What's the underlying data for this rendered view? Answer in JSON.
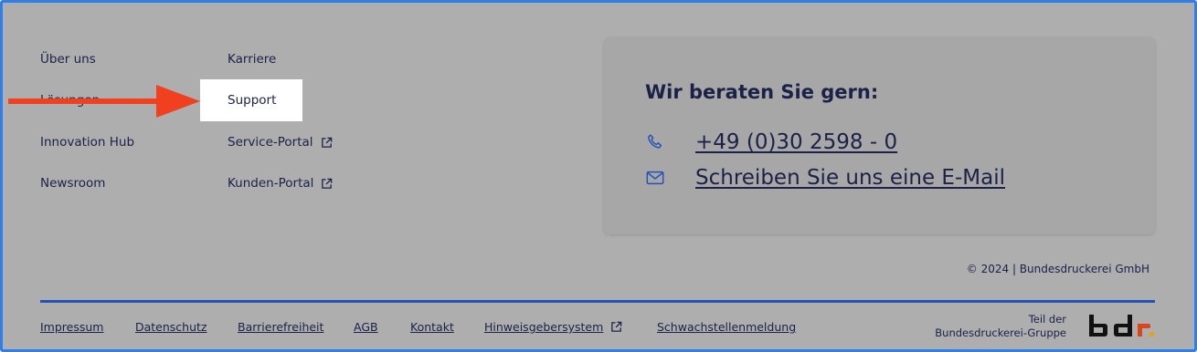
{
  "nav": {
    "col1": [
      "Über uns",
      "Lösungen",
      "Innovation Hub",
      "Newsroom"
    ],
    "col2": [
      "Karriere",
      "Support",
      "Service-Portal",
      "Kunden-Portal"
    ]
  },
  "contact": {
    "heading": "Wir beraten Sie gern:",
    "phone": "+49 (0)30 2598 - 0",
    "email_label": "Schreiben Sie uns eine E-Mail"
  },
  "copyright": "© 2024 | Bundesdruckerei GmbH",
  "footer_links": [
    "Impressum",
    "Datenschutz",
    "Barrierefreiheit",
    "AGB",
    "Kontakt",
    "Hinweisgebersystem",
    "Schwachstellenmeldung"
  ],
  "group": {
    "line1": "Teil der",
    "line2": "Bundesdruckerei-Gruppe"
  },
  "colors": {
    "overlay": "#aeaeae",
    "highlight": "#ffffff",
    "arrow": "#f0401f",
    "text": "#1b2147",
    "divider": "#2352b8",
    "border": "#2f7fe6"
  },
  "icons": {
    "phone": "phone-icon",
    "mail": "mail-icon",
    "external": "external-link-icon",
    "arrow": "arrow-right-icon",
    "logo": "bdr-logo"
  }
}
